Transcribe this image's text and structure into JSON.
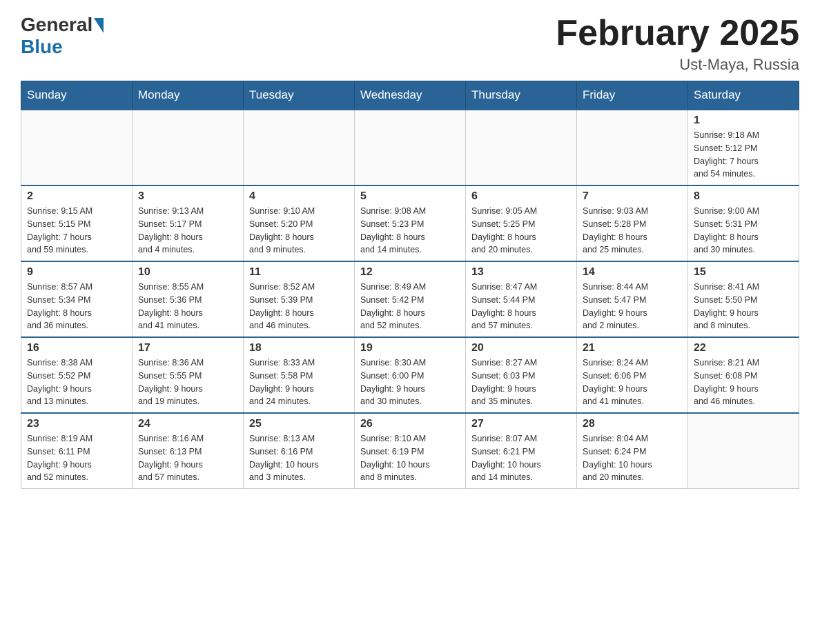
{
  "header": {
    "logo_general": "General",
    "logo_blue": "Blue",
    "month_title": "February 2025",
    "location": "Ust-Maya, Russia"
  },
  "weekdays": [
    "Sunday",
    "Monday",
    "Tuesday",
    "Wednesday",
    "Thursday",
    "Friday",
    "Saturday"
  ],
  "weeks": [
    [
      {
        "day": "",
        "info": ""
      },
      {
        "day": "",
        "info": ""
      },
      {
        "day": "",
        "info": ""
      },
      {
        "day": "",
        "info": ""
      },
      {
        "day": "",
        "info": ""
      },
      {
        "day": "",
        "info": ""
      },
      {
        "day": "1",
        "info": "Sunrise: 9:18 AM\nSunset: 5:12 PM\nDaylight: 7 hours\nand 54 minutes."
      }
    ],
    [
      {
        "day": "2",
        "info": "Sunrise: 9:15 AM\nSunset: 5:15 PM\nDaylight: 7 hours\nand 59 minutes."
      },
      {
        "day": "3",
        "info": "Sunrise: 9:13 AM\nSunset: 5:17 PM\nDaylight: 8 hours\nand 4 minutes."
      },
      {
        "day": "4",
        "info": "Sunrise: 9:10 AM\nSunset: 5:20 PM\nDaylight: 8 hours\nand 9 minutes."
      },
      {
        "day": "5",
        "info": "Sunrise: 9:08 AM\nSunset: 5:23 PM\nDaylight: 8 hours\nand 14 minutes."
      },
      {
        "day": "6",
        "info": "Sunrise: 9:05 AM\nSunset: 5:25 PM\nDaylight: 8 hours\nand 20 minutes."
      },
      {
        "day": "7",
        "info": "Sunrise: 9:03 AM\nSunset: 5:28 PM\nDaylight: 8 hours\nand 25 minutes."
      },
      {
        "day": "8",
        "info": "Sunrise: 9:00 AM\nSunset: 5:31 PM\nDaylight: 8 hours\nand 30 minutes."
      }
    ],
    [
      {
        "day": "9",
        "info": "Sunrise: 8:57 AM\nSunset: 5:34 PM\nDaylight: 8 hours\nand 36 minutes."
      },
      {
        "day": "10",
        "info": "Sunrise: 8:55 AM\nSunset: 5:36 PM\nDaylight: 8 hours\nand 41 minutes."
      },
      {
        "day": "11",
        "info": "Sunrise: 8:52 AM\nSunset: 5:39 PM\nDaylight: 8 hours\nand 46 minutes."
      },
      {
        "day": "12",
        "info": "Sunrise: 8:49 AM\nSunset: 5:42 PM\nDaylight: 8 hours\nand 52 minutes."
      },
      {
        "day": "13",
        "info": "Sunrise: 8:47 AM\nSunset: 5:44 PM\nDaylight: 8 hours\nand 57 minutes."
      },
      {
        "day": "14",
        "info": "Sunrise: 8:44 AM\nSunset: 5:47 PM\nDaylight: 9 hours\nand 2 minutes."
      },
      {
        "day": "15",
        "info": "Sunrise: 8:41 AM\nSunset: 5:50 PM\nDaylight: 9 hours\nand 8 minutes."
      }
    ],
    [
      {
        "day": "16",
        "info": "Sunrise: 8:38 AM\nSunset: 5:52 PM\nDaylight: 9 hours\nand 13 minutes."
      },
      {
        "day": "17",
        "info": "Sunrise: 8:36 AM\nSunset: 5:55 PM\nDaylight: 9 hours\nand 19 minutes."
      },
      {
        "day": "18",
        "info": "Sunrise: 8:33 AM\nSunset: 5:58 PM\nDaylight: 9 hours\nand 24 minutes."
      },
      {
        "day": "19",
        "info": "Sunrise: 8:30 AM\nSunset: 6:00 PM\nDaylight: 9 hours\nand 30 minutes."
      },
      {
        "day": "20",
        "info": "Sunrise: 8:27 AM\nSunset: 6:03 PM\nDaylight: 9 hours\nand 35 minutes."
      },
      {
        "day": "21",
        "info": "Sunrise: 8:24 AM\nSunset: 6:06 PM\nDaylight: 9 hours\nand 41 minutes."
      },
      {
        "day": "22",
        "info": "Sunrise: 8:21 AM\nSunset: 6:08 PM\nDaylight: 9 hours\nand 46 minutes."
      }
    ],
    [
      {
        "day": "23",
        "info": "Sunrise: 8:19 AM\nSunset: 6:11 PM\nDaylight: 9 hours\nand 52 minutes."
      },
      {
        "day": "24",
        "info": "Sunrise: 8:16 AM\nSunset: 6:13 PM\nDaylight: 9 hours\nand 57 minutes."
      },
      {
        "day": "25",
        "info": "Sunrise: 8:13 AM\nSunset: 6:16 PM\nDaylight: 10 hours\nand 3 minutes."
      },
      {
        "day": "26",
        "info": "Sunrise: 8:10 AM\nSunset: 6:19 PM\nDaylight: 10 hours\nand 8 minutes."
      },
      {
        "day": "27",
        "info": "Sunrise: 8:07 AM\nSunset: 6:21 PM\nDaylight: 10 hours\nand 14 minutes."
      },
      {
        "day": "28",
        "info": "Sunrise: 8:04 AM\nSunset: 6:24 PM\nDaylight: 10 hours\nand 20 minutes."
      },
      {
        "day": "",
        "info": ""
      }
    ]
  ]
}
